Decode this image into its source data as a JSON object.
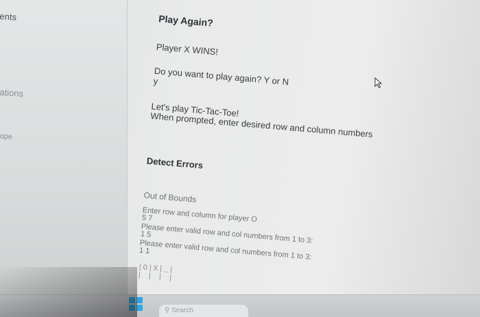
{
  "sidebar": {
    "items": [
      {
        "label": "ents"
      },
      {
        "label": "ations"
      },
      {
        "label": "ope"
      }
    ]
  },
  "content": {
    "title": "Play Again?",
    "winner_line": "Player X WINS!",
    "prompt_line": "Do you want to play again? Y or N",
    "answer_line": "y",
    "intro_line1": "Let's play Tic-Tac-Toe!",
    "intro_line2": "When prompted, enter desired row and column numbers",
    "section_title": "Detect Errors",
    "subtitle": "Out of Bounds",
    "enter_prompt": "Enter row and column for player O",
    "input1": "5 7",
    "error1": "Please enter valid row and col numbers from 1 to 3:",
    "input2": "1 5",
    "error2": "Please enter valid row and col numbers from 1 to 3:",
    "input3": "1 1",
    "board_row1": "|O|X|_|",
    "board_row2": "| | | |"
  },
  "taskbar": {
    "search_placeholder": "Search"
  }
}
